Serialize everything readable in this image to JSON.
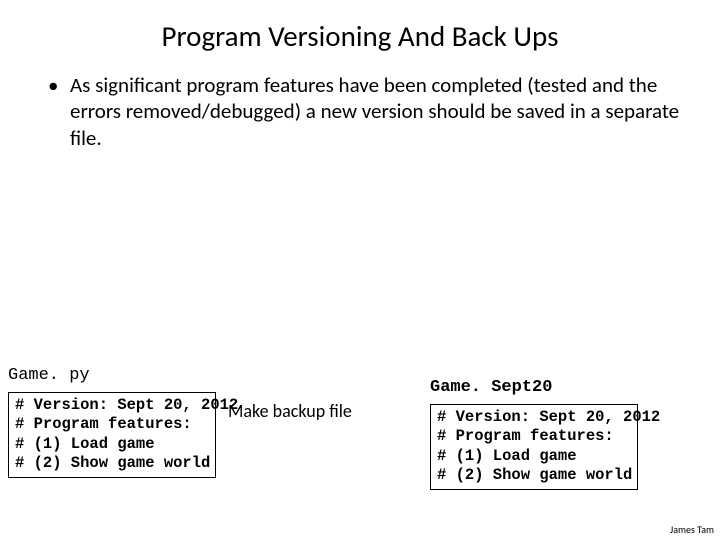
{
  "title": "Program Versioning And Back Ups",
  "bullet_dot": "•",
  "bullet_text": "As significant program features have been completed (tested and the errors removed/debugged) a new version should be saved in a separate file.",
  "file_left_label": "Game. py",
  "file_right_label": "Game. Sept20",
  "code_left": "# Version: Sept 20, 2012\n# Program features:\n# (1) Load game\n# (2) Show game world",
  "code_right": "# Version: Sept 20, 2012\n# Program features:\n# (1) Load game\n# (2) Show game world",
  "arrow_label": "Make backup file",
  "attribution": "James Tam"
}
